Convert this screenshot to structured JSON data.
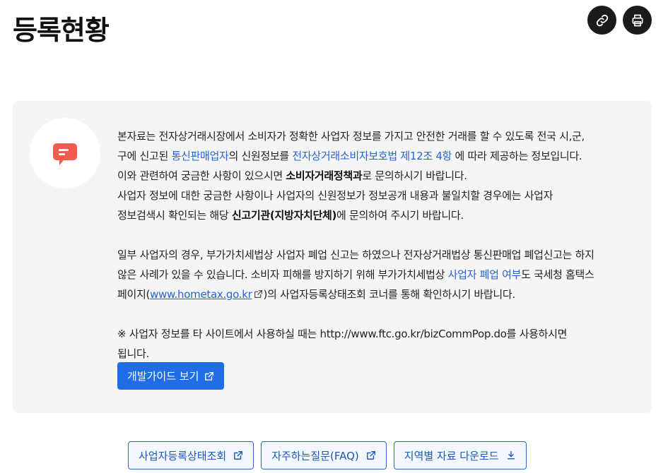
{
  "page": {
    "title": "등록현황"
  },
  "top_actions": {
    "link_icon": "link-icon",
    "print_icon": "print-icon"
  },
  "info": {
    "avatar_icon": "chat-bubble-icon",
    "p1_a": "본자료는 전자상거래시장에서 소비자가 정확한 사업자 정보를 가지고 안전한 거래를 할 수 있도록 전국 시,군,",
    "p1_b": "구에 신고된 ",
    "p1_link1": "통신판매업자",
    "p1_c": "의 신원정보를 ",
    "p1_link2": "전자상거래소비자보호법 제12조 4항",
    "p1_d": " 에 따라 제공하는 정보입니다.",
    "p2_a": "이와 관련하여 궁금한 사항이 있으시면 ",
    "p2_bold": "소비자거래정책과",
    "p2_b": "로 문의하시기 바랍니다.",
    "p3_a": "사업자 정보에 대한 궁금한 사항이나 사업자의 신원정보가 정보공개 내용과 불일치할 경우에는 사업자",
    "p3_b": "정보검색시 확인되는 해당 ",
    "p3_bold": "신고기관(지방자치단체)",
    "p3_c": "에 문의하여 주시기 바랍니다.",
    "p4_a": "일부 사업자의 경우, 부가가치세법상 사업자 폐업 신고는 하였으나 전자상거래법상 통신판매업 폐업신고는 하지",
    "p4_b": "않은 사례가 있을 수 있습니다. 소비자 피해를 방지하기 위해 부가가치세법상 ",
    "p4_link": "사업자 폐업 여부",
    "p4_c": "도 국세청 홈택스",
    "p4_d": "페이지(",
    "p4_url": "www.hometax.go.kr",
    "p4_e": ")의 사업자등록상태조회 코너를 통해 확인하시기 바랍니다.",
    "p5_a": "※ 사업자 정보를 타 사이트에서 사용하실 때는 http://www.ftc.go.kr/bizCommPop.do를 사용하시면",
    "p5_b": "됩니다.",
    "guide_button": "개발가이드 보기"
  },
  "bottom_buttons": [
    {
      "label": "사업자등록상태조회",
      "icon": "external-link-icon"
    },
    {
      "label": "자주하는질문(FAQ)",
      "icon": "external-link-icon"
    },
    {
      "label": "지역별 자료 다운로드",
      "icon": "download-icon"
    }
  ],
  "colors": {
    "accent": "#1f6ee6",
    "link": "#2563d9",
    "panel_bg": "#f5f5f5",
    "chat_icon": "#f25c4f"
  }
}
